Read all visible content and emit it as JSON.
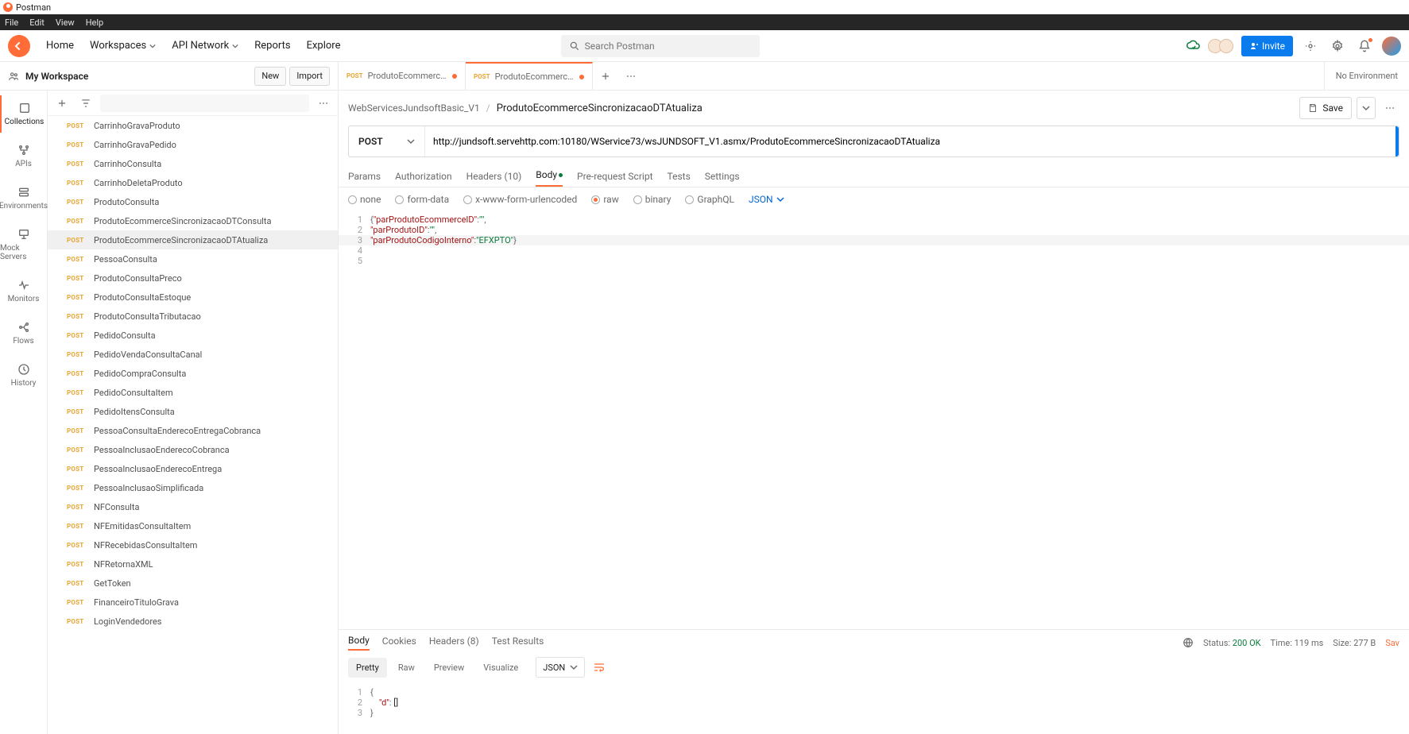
{
  "titlebar": {
    "app_name": "Postman"
  },
  "menubar": {
    "items": [
      "File",
      "Edit",
      "View",
      "Help"
    ]
  },
  "topbar": {
    "nav": {
      "home": "Home",
      "workspaces": "Workspaces",
      "api_network": "API Network",
      "reports": "Reports",
      "explore": "Explore"
    },
    "search_placeholder": "Search Postman",
    "invite": "Invite"
  },
  "workspace": {
    "name": "My Workspace",
    "buttons": {
      "new": "New",
      "import": "Import"
    }
  },
  "rail": {
    "collections": "Collections",
    "apis": "APIs",
    "environments": "Environments",
    "mock": "Mock Servers",
    "monitors": "Monitors",
    "flows": "Flows",
    "history": "History"
  },
  "tree": {
    "method_label": "POST",
    "items": [
      "CarrinhoGravaProduto",
      "CarrinhoGravaPedido",
      "CarrinhoConsulta",
      "CarrinhoDeletaProduto",
      "ProdutoConsulta",
      "ProdutoEcommerceSincronizacaoDTConsulta",
      "ProdutoEcommerceSincronizacaoDTAtualiza",
      "PessoaConsulta",
      "ProdutoConsultaPreco",
      "ProdutoConsultaEstoque",
      "ProdutoConsultaTributacao",
      "PedidoConsulta",
      "PedidoVendaConsultaCanal",
      "PedidoCompraConsulta",
      "PedidoConsultaItem",
      "PedidoItensConsulta",
      "PessoaConsultaEnderecoEntregaCobranca",
      "PessoaInclusaoEnderecoCobranca",
      "PessoaInclusaoEnderecoEntrega",
      "PessoaInclusaoSimplificada",
      "NFConsulta",
      "NFEmitidasConsultaItem",
      "NFRecebidasConsultaItem",
      "NFRetornaXML",
      "GetToken",
      "FinanceiroTituloGrava",
      "LoginVendedores"
    ],
    "selected_index": 6
  },
  "tabs": {
    "method_label": "POST",
    "items": [
      {
        "title": "ProdutoEcommerceSi",
        "unsaved": true
      },
      {
        "title": "ProdutoEcommerceSi",
        "unsaved": true
      }
    ],
    "active_index": 1,
    "environment": "No Environment"
  },
  "breadcrumb": {
    "parent": "WebServicesJundsoftBasic_V1",
    "current": "ProdutoEcommerceSincronizacaoDTAtualiza",
    "save": "Save"
  },
  "request": {
    "method": "POST",
    "url": "http://jundsoft.servehttp.com:10180/WService73/wsJUNDSOFT_V1.asmx/ProdutoEcommerceSincronizacaoDTAtualiza",
    "tabs": {
      "params": "Params",
      "auth": "Authorization",
      "headers": "Headers (10)",
      "body": "Body",
      "prerequest": "Pre-request Script",
      "tests": "Tests",
      "settings": "Settings"
    },
    "body_types": {
      "none": "none",
      "formdata": "form-data",
      "urlencoded": "x-www-form-urlencoded",
      "raw": "raw",
      "binary": "binary",
      "graphql": "GraphQL"
    },
    "format": "JSON",
    "body": {
      "k1": "parProdutoEcommerceID",
      "v1": "",
      "k2": "parProdutoID",
      "v2": "",
      "k3": "parProdutoCodigoInterno",
      "v3": "EFXPTO"
    }
  },
  "response": {
    "tabs": {
      "body": "Body",
      "cookies": "Cookies",
      "headers": "Headers (8)",
      "tests": "Test Results"
    },
    "meta": {
      "status_label": "Status:",
      "status_value": "200 OK",
      "time_label": "Time:",
      "time_value": "119 ms",
      "size_label": "Size:",
      "size_value": "277 B",
      "save_link": "Sav"
    },
    "modes": {
      "pretty": "Pretty",
      "raw": "Raw",
      "preview": "Preview",
      "visualize": "Visualize"
    },
    "format": "JSON",
    "body": {
      "key": "d",
      "value": "[]"
    }
  }
}
